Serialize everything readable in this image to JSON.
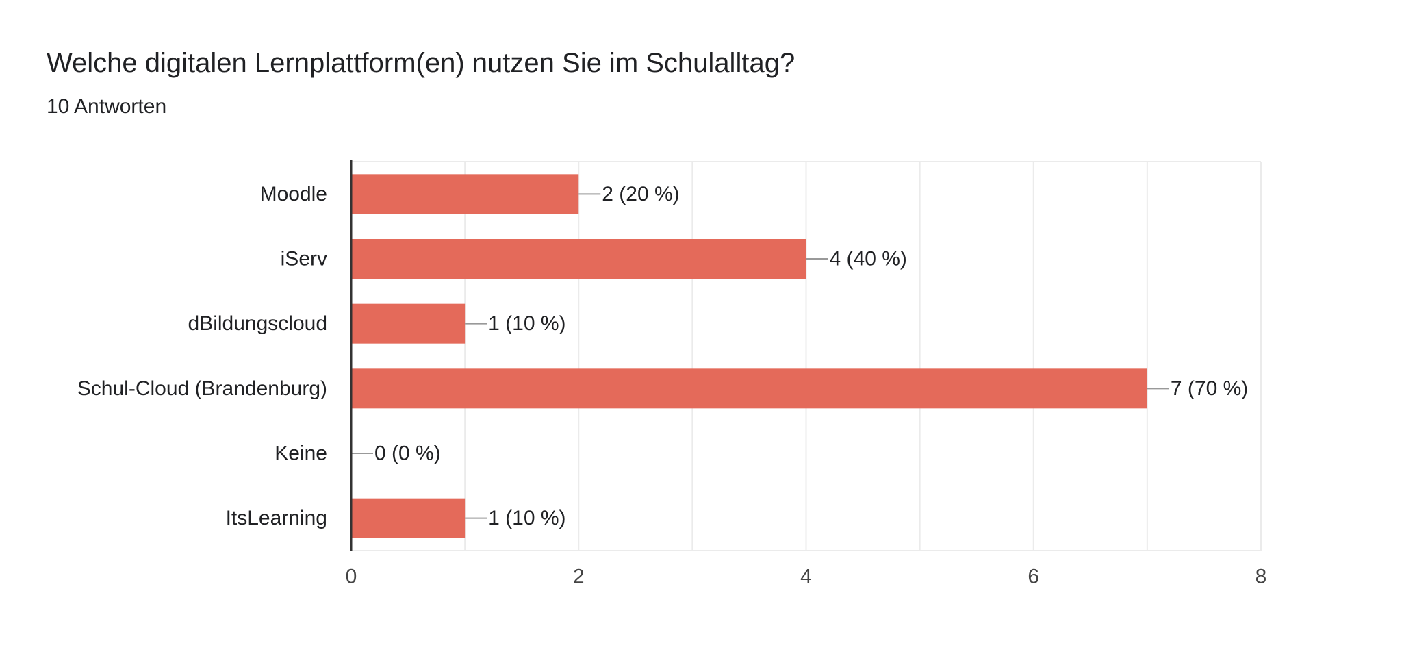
{
  "page": {
    "title": "Welche digitalen Lernplattform(en) nutzen Sie im Schulalltag?",
    "subtitle": "10 Antworten"
  },
  "colors": {
    "bar": "#e46a5a",
    "axis": "#333333",
    "grid": "#ebebeb",
    "text": "#202124",
    "tick_text": "#444444",
    "leader": "#999999"
  },
  "chart_data": {
    "type": "bar",
    "orientation": "horizontal",
    "categories": [
      "Moodle",
      "iServ",
      "dBildungscloud",
      "Schul-Cloud (Brandenburg)",
      "Keine",
      "ItsLearning"
    ],
    "values": [
      2,
      4,
      1,
      7,
      0,
      1
    ],
    "data_labels": [
      "2 (20 %)",
      "4 (40 %)",
      "1 (10 %)",
      "7 (70 %)",
      "0 (0 %)",
      "1 (10 %)"
    ],
    "xlim": [
      0,
      8
    ],
    "x_ticks": [
      0,
      2,
      4,
      6,
      8
    ],
    "grid": true
  }
}
